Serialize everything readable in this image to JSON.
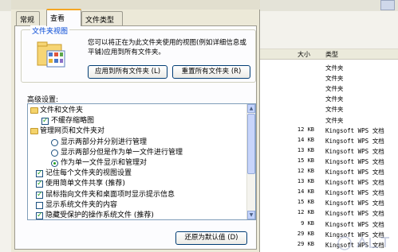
{
  "dialog": {
    "tabs": [
      {
        "label": "常规",
        "active": false
      },
      {
        "label": "查看",
        "active": true
      },
      {
        "label": "文件类型",
        "active": false
      }
    ],
    "folder_views": {
      "legend": "文件夹视图",
      "description": "您可以将正在为此文件夹使用的视图(例如详细信息或平铺)应用到所有文件夹。",
      "apply_all_button": "应用到所有文件夹 (L)",
      "reset_all_button": "重置所有文件夹 (R)"
    },
    "advanced": {
      "label": "高级设置:",
      "items": [
        {
          "kind": "folder",
          "text": "文件和文件夹"
        },
        {
          "kind": "check",
          "checked": true,
          "text": "不缓存缩略图"
        },
        {
          "kind": "folder",
          "text": "管理网页和文件夹对"
        },
        {
          "kind": "radio",
          "checked": false,
          "text": "显示两部分并分别进行管理"
        },
        {
          "kind": "radio",
          "checked": false,
          "text": "显示两部分但是作为单一文件进行管理"
        },
        {
          "kind": "radio",
          "checked": true,
          "text": "作为单一文件显示和管理对"
        },
        {
          "kind": "check",
          "checked": true,
          "text": "记住每个文件夹的视图设置"
        },
        {
          "kind": "check",
          "checked": true,
          "text": "使用简单文件共享 (推荐)"
        },
        {
          "kind": "check",
          "checked": true,
          "text": "鼠标指向文件夹和桌面项时显示提示信息"
        },
        {
          "kind": "check",
          "checked": false,
          "text": "显示系统文件夹的内容"
        },
        {
          "kind": "check",
          "checked": true,
          "text": "隐藏受保护的操作系统文件 (推荐)"
        }
      ],
      "restore_defaults_button": "还原为默认值 (D)"
    }
  },
  "background_list": {
    "columns": {
      "size": "大小",
      "type": "类型"
    },
    "rows": [
      {
        "size": "",
        "type": "文件夹"
      },
      {
        "size": "",
        "type": "文件夹"
      },
      {
        "size": "",
        "type": "文件夹"
      },
      {
        "size": "",
        "type": "文件夹"
      },
      {
        "size": "",
        "type": "文件夹"
      },
      {
        "size": "",
        "type": "文件夹"
      },
      {
        "size": "12 KB",
        "type": "Kingsoft WPS 文档"
      },
      {
        "size": "14 KB",
        "type": "Kingsoft WPS 文档"
      },
      {
        "size": "13 KB",
        "type": "Kingsoft WPS 文档"
      },
      {
        "size": "15 KB",
        "type": "Kingsoft WPS 文档"
      },
      {
        "size": "12 KB",
        "type": "Kingsoft WPS 文档"
      },
      {
        "size": "13 KB",
        "type": "Kingsoft WPS 文档"
      },
      {
        "size": "14 KB",
        "type": "Kingsoft WPS 文档"
      },
      {
        "size": "15 KB",
        "type": "Kingsoft WPS 文档"
      },
      {
        "size": "12 KB",
        "type": "Kingsoft WPS 文档"
      },
      {
        "size": "9 KB",
        "type": "Kingsoft WPS 文档"
      },
      {
        "size": "29 KB",
        "type": "Kingsoft WPS 文档"
      },
      {
        "size": "29 KB",
        "type": "Kingsoft WPS 文档"
      }
    ]
  },
  "colors": {
    "accent_tab": "#f5a623",
    "legend_blue": "#0046d5",
    "check_green": "#21a121"
  }
}
